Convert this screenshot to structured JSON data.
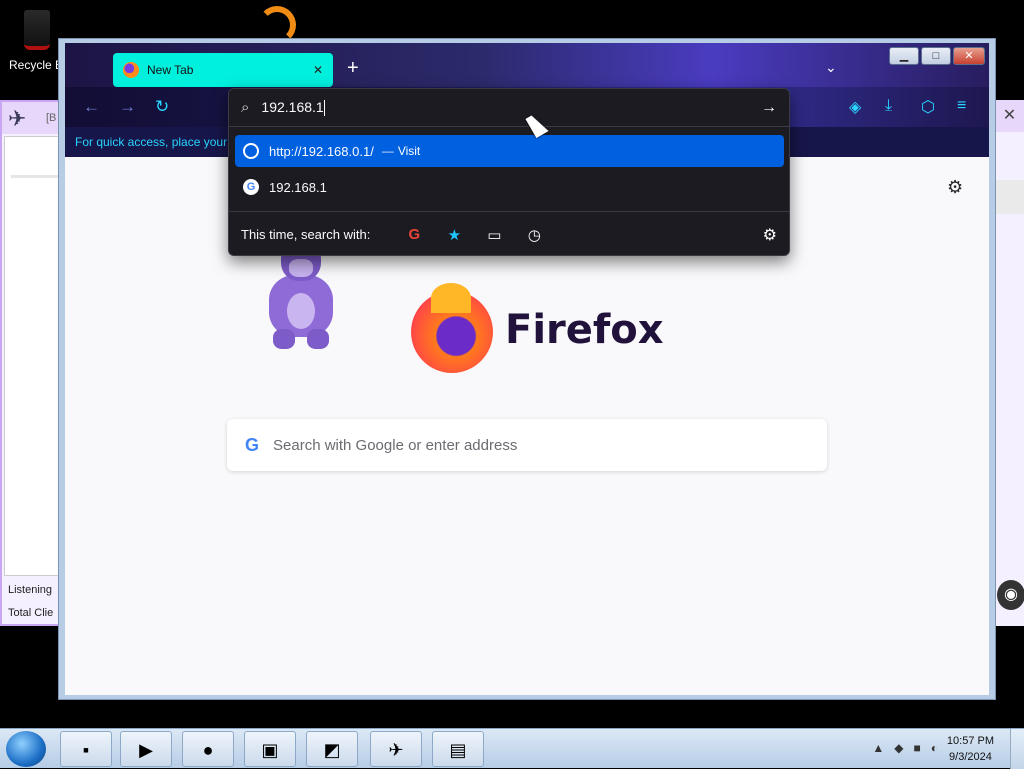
{
  "desktop": {
    "recycle_label": "Recycle B",
    "bgapp": {
      "title_fragment": "[B",
      "status_listening": "Listening",
      "status_total": "Total Clie"
    }
  },
  "firefox": {
    "tab": {
      "title": "New Tab",
      "close": "✕"
    },
    "new_tab_glyph": "+",
    "list_tabs_glyph": "⌄",
    "window_buttons": {
      "minimize": "▁",
      "maximize": "□",
      "close": "✕"
    },
    "nav": {
      "back": "←",
      "forward": "→",
      "reload": "↻"
    },
    "toolbar_right": {
      "pocket": "◈",
      "downloads": "⤓",
      "extensions": "⬡",
      "menu": "≡"
    },
    "bookmarks_hint": "For quick access, place your b",
    "url_dropdown": {
      "typed_text": "192.168.1",
      "go_glyph": "→",
      "suggestions": [
        {
          "text": "http://192.168.0.1/",
          "separator": "—",
          "action": "Visit",
          "selected": true
        },
        {
          "text": "192.168.1",
          "selected": false
        }
      ],
      "search_with_label": "This time, search with:",
      "engines": [
        "google-icon",
        "star-icon",
        "tab-icon",
        "history-icon"
      ]
    },
    "newtab": {
      "wordmark": "Firefox",
      "search_placeholder": "Search with Google or enter address",
      "google_glyph": "G"
    }
  },
  "taskbar": {
    "time": "10:57 PM",
    "date": "9/3/2024",
    "tray_expand": "▲"
  }
}
